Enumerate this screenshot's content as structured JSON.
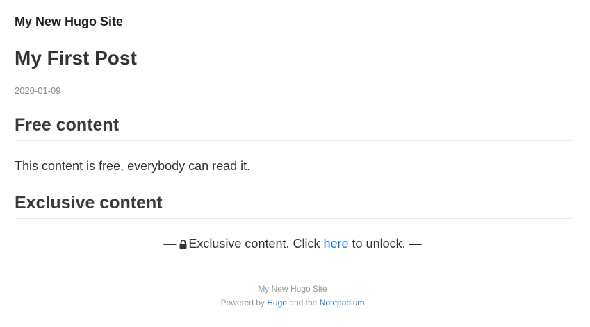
{
  "site": {
    "title": "My New Hugo Site"
  },
  "post": {
    "title": "My First Post",
    "date": "2020-01-09"
  },
  "sections": {
    "free": {
      "heading": "Free content",
      "text": "This content is free, everybody can read it."
    },
    "exclusive": {
      "heading": "Exclusive content",
      "prefix_dash": "—",
      "lock_icon": "lock-icon",
      "text_before": "Exclusive content. Click",
      "link_text": "here",
      "text_after": "to unlock.",
      "suffix_dash": "—"
    }
  },
  "footer": {
    "site_name": "My New Hugo Site",
    "powered_by": "Powered by",
    "hugo_link": "Hugo",
    "and_the": "and the",
    "theme_link": "Notepadium"
  },
  "colors": {
    "link": "#0b76d9",
    "text": "#333333",
    "muted": "#999999"
  }
}
